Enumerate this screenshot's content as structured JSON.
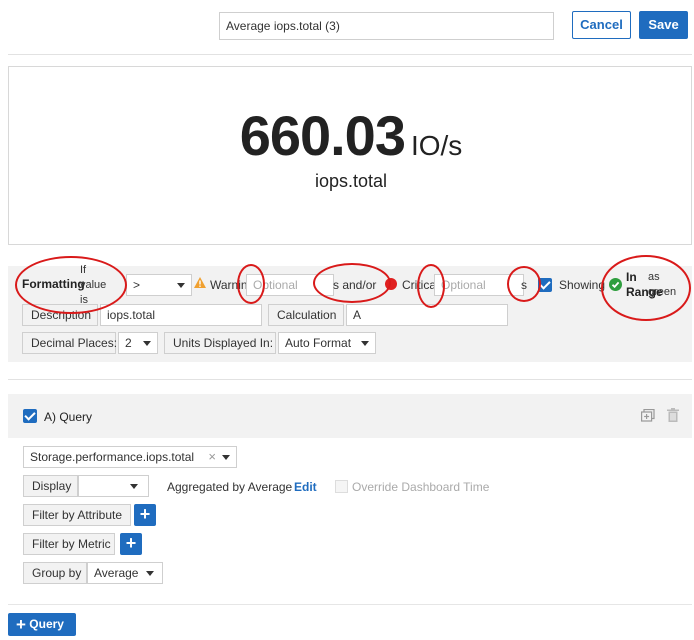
{
  "header": {
    "title_value": "Average iops.total (3)",
    "cancel_label": "Cancel",
    "save_label": "Save"
  },
  "preview": {
    "value": "660.03",
    "unit": "IO/s",
    "metric": "iops.total"
  },
  "formatting": {
    "label": "Formatting",
    "if_value_is": "If value is",
    "operator": ">",
    "warning_label": "Warning",
    "warning_placeholder": "Optional",
    "and_or": "s and/or",
    "critical_label": "Critical",
    "critical_placeholder": "Optional",
    "suffix": "s",
    "showing_label": "Showing",
    "in_range_label": "In Range",
    "as_green": "as green"
  },
  "description": {
    "label": "Description",
    "value": "iops.total"
  },
  "calculation": {
    "label": "Calculation",
    "value": "A"
  },
  "decimal_places": {
    "label": "Decimal Places:",
    "value": "2"
  },
  "units": {
    "label": "Units Displayed In:",
    "value": "Auto Format"
  },
  "query": {
    "title": "A) Query",
    "metric": "Storage.performance.iops.total",
    "display_label": "Display",
    "display_value": "",
    "aggregated_text": "Aggregated by Average",
    "edit_label": "Edit",
    "override_label": "Override Dashboard Time",
    "filter_attribute_label": "Filter by Attribute",
    "filter_metric_label": "Filter by Metric",
    "group_by_label": "Group by",
    "group_by_value": "Average"
  },
  "add_query_label": "Query",
  "colors": {
    "primary": "#1f6cbf",
    "annotation": "#d91a1a",
    "warning": "#f0a030",
    "critical": "#e02020",
    "success": "#2e9e3e"
  }
}
